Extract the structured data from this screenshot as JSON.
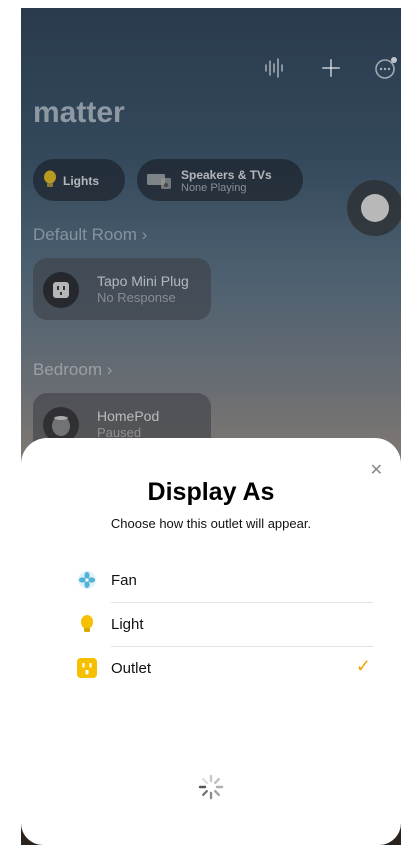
{
  "background": {
    "title": "matter",
    "chips": [
      {
        "label": "Lights",
        "icon": "bulb-icon",
        "color": "#f6c000"
      },
      {
        "label": "Speakers & TVs",
        "sublabel": "None Playing",
        "icon": "speaker-tv-icon"
      }
    ],
    "rooms": [
      {
        "name": "Default Room",
        "accessory": {
          "name": "Tapo Mini Plug",
          "status": "No Response",
          "icon": "outlet-icon"
        }
      },
      {
        "name": "Bedroom",
        "accessory": {
          "name": "HomePod",
          "status": "Paused",
          "icon": "homepod-icon"
        }
      }
    ]
  },
  "sheet": {
    "title": "Display As",
    "subtitle": "Choose how this outlet will appear.",
    "close_icon": "close-icon",
    "options": [
      {
        "label": "Fan",
        "icon": "fan-icon",
        "selected": false
      },
      {
        "label": "Light",
        "icon": "bulb-icon",
        "selected": false
      },
      {
        "label": "Outlet",
        "icon": "outlet-icon",
        "selected": true
      }
    ],
    "accent_color": "#f2a400",
    "loading": true
  }
}
